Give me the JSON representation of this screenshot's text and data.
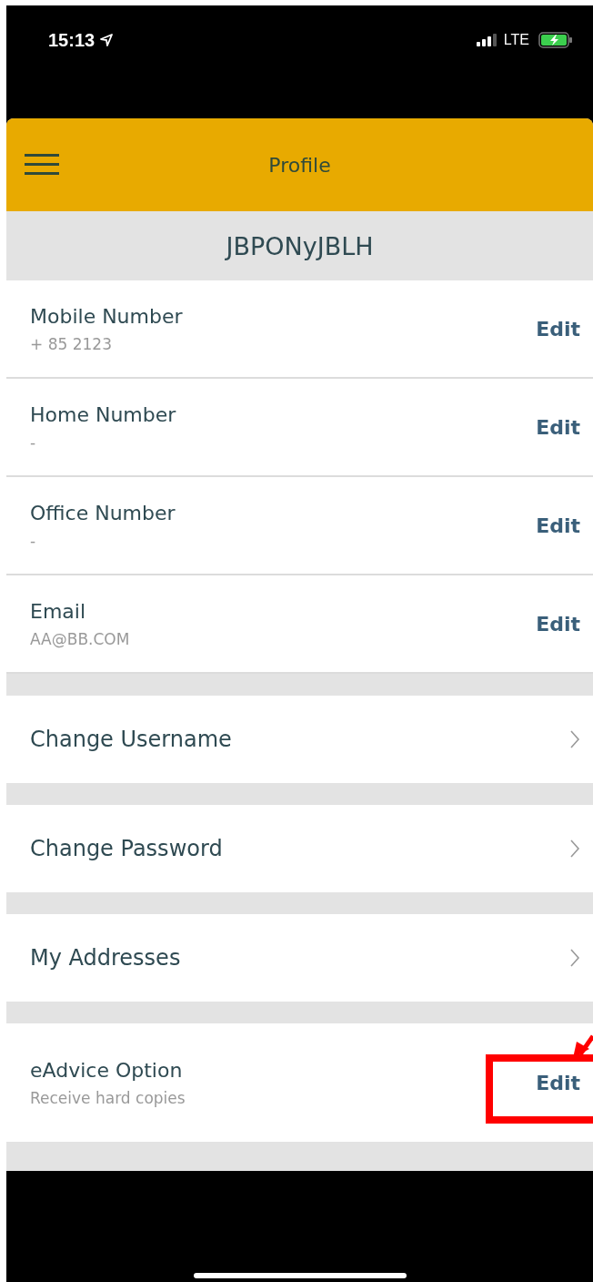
{
  "status_bar": {
    "time": "15:13",
    "network": "LTE"
  },
  "header": {
    "title": "Profile"
  },
  "username": "JBPONyJBLH",
  "contact_fields": [
    {
      "label": "Mobile Number",
      "value": "+ 85 2123",
      "action": "Edit"
    },
    {
      "label": "Home Number",
      "value": "-",
      "action": "Edit"
    },
    {
      "label": "Office Number",
      "value": "-",
      "action": "Edit"
    },
    {
      "label": "Email",
      "value": "AA@BB.COM",
      "action": "Edit"
    }
  ],
  "links": [
    {
      "label": "Change Username"
    },
    {
      "label": "Change Password"
    },
    {
      "label": "My Addresses"
    }
  ],
  "eadvice": {
    "label": "eAdvice Option",
    "value": "Receive hard copies",
    "action": "Edit",
    "highlighted": true
  }
}
